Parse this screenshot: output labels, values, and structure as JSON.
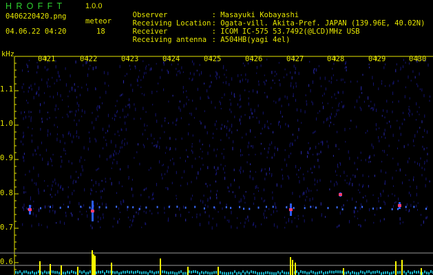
{
  "app": {
    "logo": "HROFFT",
    "version": "1.0.0"
  },
  "file": {
    "name": "0406220420.png",
    "timestamp": "04.06.22 04:20"
  },
  "meteor": {
    "label": "meteor",
    "count": "18"
  },
  "info": [
    {
      "key": "Observer",
      "value": ": Masayuki Kobayashi"
    },
    {
      "key": "Receiving Location",
      "value": ": Ogata-vill. Akita-Pref. JAPAN (139.96E, 40.02N)"
    },
    {
      "key": "Receiver",
      "value": ": ICOM IC-575 53.7492(@LCD)MHz USB"
    },
    {
      "key": "Receiving antenna",
      "value": ": A504HB(yagi 4el)"
    }
  ],
  "axis": {
    "unit": "kHz",
    "time_labels": [
      "0421",
      "0422",
      "0423",
      "0424",
      "0425",
      "0426",
      "0427",
      "0428",
      "0429",
      "0430"
    ],
    "freq_labels": [
      "1.1",
      "1.0",
      "0.9",
      "0.8",
      "0.7",
      "0.6"
    ]
  },
  "colors": {
    "text": "#e6e600",
    "logo": "#2fd22f",
    "background": "#000000",
    "echo": "#ff3b6b",
    "meteor_bar": "#ffff00",
    "noise": "#0a0a55"
  }
}
